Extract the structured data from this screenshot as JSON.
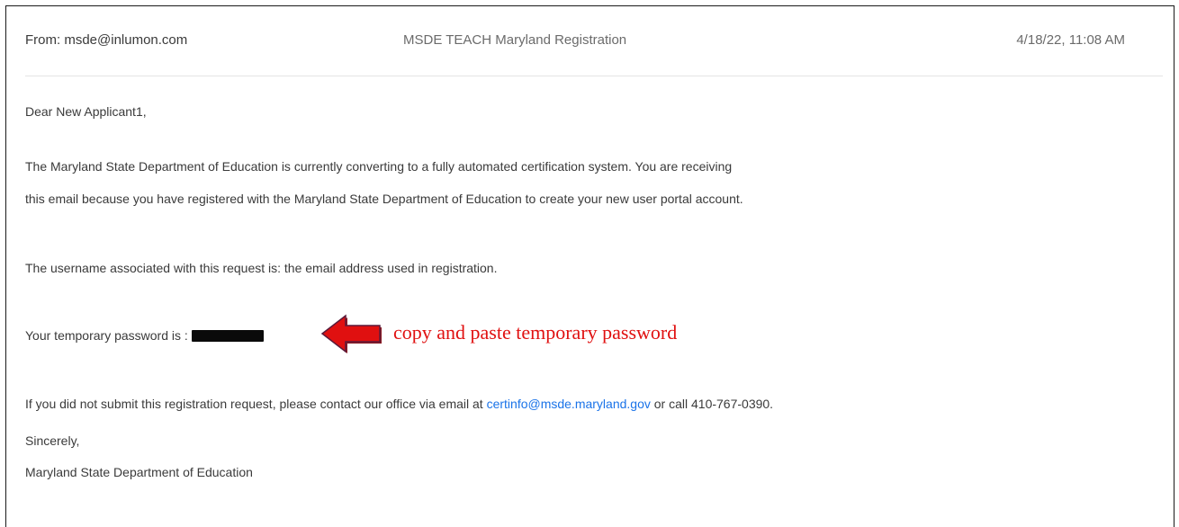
{
  "email": {
    "from": "From: msde@inlumon.com",
    "subject": "MSDE TEACH Maryland Registration",
    "date": "4/18/22, 11:08 AM",
    "greeting": "Dear New Applicant1,",
    "para1_line1": "The Maryland State Department of Education is currently converting to a fully automated certification system.  You are receiving",
    "para1_line2": "this email because you have registered with the Maryland State Department of Education to create your new user portal account.",
    "username_line": "The username associated with this request is: the email address used in registration.",
    "password_label": "Your temporary password is :",
    "contact_prefix": "If you did not submit this registration request, please contact our office via email at ",
    "contact_email": "certinfo@msde.maryland.gov",
    "contact_suffix": " or call 410-767-0390.",
    "closing": "Sincerely,",
    "signature": "Maryland State Department of Education"
  },
  "annotation": {
    "text": "copy and paste temporary password",
    "arrow_icon": "red-left-arrow-icon",
    "color": "#e01010"
  }
}
